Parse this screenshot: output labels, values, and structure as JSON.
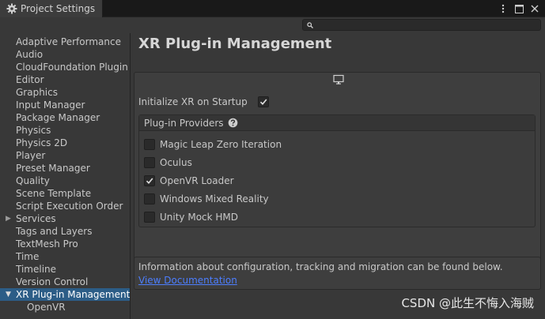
{
  "window": {
    "tab_title": "Project Settings",
    "tab_icon": "gear-icon"
  },
  "search": {
    "placeholder": ""
  },
  "sidebar": {
    "items": [
      {
        "label": "Adaptive Performance"
      },
      {
        "label": "Audio"
      },
      {
        "label": "CloudFoundation Plugin"
      },
      {
        "label": "Editor"
      },
      {
        "label": "Graphics"
      },
      {
        "label": "Input Manager"
      },
      {
        "label": "Package Manager"
      },
      {
        "label": "Physics"
      },
      {
        "label": "Physics 2D"
      },
      {
        "label": "Player"
      },
      {
        "label": "Preset Manager"
      },
      {
        "label": "Quality"
      },
      {
        "label": "Scene Template"
      },
      {
        "label": "Script Execution Order"
      },
      {
        "label": "Services",
        "collapsed": true
      },
      {
        "label": "Tags and Layers"
      },
      {
        "label": "TextMesh Pro"
      },
      {
        "label": "Time"
      },
      {
        "label": "Timeline"
      },
      {
        "label": "Version Control"
      },
      {
        "label": "XR Plug-in Management",
        "expanded": true,
        "selected": true
      },
      {
        "label": "OpenVR",
        "sub": true
      }
    ]
  },
  "main": {
    "title": "XR Plug-in Management",
    "platform_icon": "monitor-icon",
    "initialize_label": "Initialize XR on Startup",
    "initialize_checked": true,
    "providers_header": "Plug-in Providers",
    "providers": [
      {
        "label": "Magic Leap Zero Iteration",
        "checked": false
      },
      {
        "label": "Oculus",
        "checked": false
      },
      {
        "label": "OpenVR Loader",
        "checked": true
      },
      {
        "label": "Windows Mixed Reality",
        "checked": false
      },
      {
        "label": "Unity Mock HMD",
        "checked": false
      }
    ],
    "info_text": "Information about configuration, tracking and migration can be found below.",
    "info_link": "View Documentation"
  },
  "watermark": "CSDN @此生不悔入海贼",
  "colors": {
    "selection": "#2c5d87",
    "link": "#4c7eff",
    "background": "#383838"
  }
}
